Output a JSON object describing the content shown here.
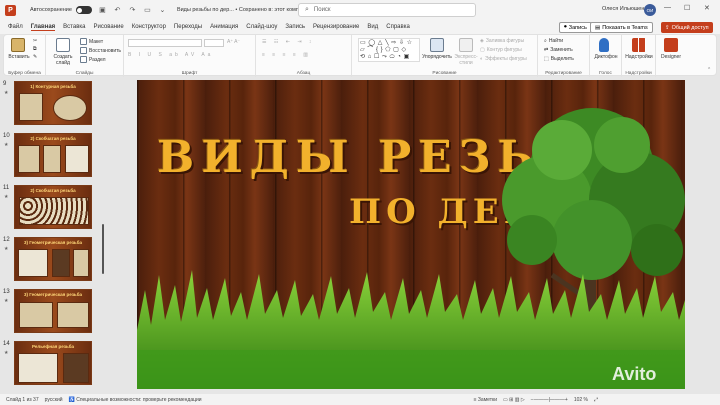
{
  "titlebar": {
    "logo": "P",
    "autosave_label": "Автосохранение",
    "doc_title": "Виды резьбы по дер... • Сохранено в: этот компьютер",
    "search_placeholder": "Поиск",
    "user_name": "Олеся Ильюшенко",
    "user_initials": "ОИ"
  },
  "tabs": [
    "Файл",
    "Главная",
    "Вставка",
    "Рисование",
    "Конструктор",
    "Переходы",
    "Анимация",
    "Слайд-шоу",
    "Запись",
    "Рецензирование",
    "Вид",
    "Справка"
  ],
  "active_tab": "Главная",
  "actions": {
    "record": "Запись",
    "present_teams": "Показать в Teams",
    "share": "Общий доступ"
  },
  "ribbon": {
    "clipboard": {
      "paste": "Вставить",
      "label": "Буфер обмена"
    },
    "slides": {
      "new_slide": "Создать слайд",
      "layout": "Макет",
      "reset": "Восстановить",
      "section": "Раздел",
      "label": "Слайды"
    },
    "font": {
      "label": "Шрифт"
    },
    "paragraph": {
      "label": "Абзац"
    },
    "drawing": {
      "arrange": "Упорядочить",
      "quick_styles": "Экспресс-стили",
      "fill": "Заливка фигуры",
      "outline": "Контур фигуры",
      "effects": "Эффекты фигуры",
      "label": "Рисование"
    },
    "editing": {
      "find": "Найти",
      "replace": "Заменить",
      "select": "Выделить",
      "label": "Редактирование"
    },
    "voice": {
      "dictate": "Диктофон",
      "label": "Голос"
    },
    "addins": {
      "addins_btn": "Надстройки",
      "label": "Надстройки"
    },
    "designer": {
      "label": "Designer"
    }
  },
  "thumbnails": [
    {
      "num": "9",
      "title": "1) Контурная резьба",
      "selected": false
    },
    {
      "num": "10",
      "title": "2) Скобчатая резьба",
      "selected": false
    },
    {
      "num": "11",
      "title": "2) Скобчатая резьба",
      "selected": false
    },
    {
      "num": "12",
      "title": "3) Геометрическая резьба",
      "selected": false
    },
    {
      "num": "13",
      "title": "3) Геометрическая резьба",
      "selected": false
    },
    {
      "num": "14",
      "title": "Рельефная резьба",
      "selected": false
    }
  ],
  "slide": {
    "title_line1": "ВИДЫ РЕЗЬБЫ",
    "title_line2": "ПО ДЕРЕВУ"
  },
  "statusbar": {
    "slide_info": "Слайд 1 из 37",
    "language": "русский",
    "accessibility": "Специальные возможности: проверьте рекомендации",
    "notes": "Заметки",
    "zoom": "102 %"
  },
  "watermark": "Avito"
}
